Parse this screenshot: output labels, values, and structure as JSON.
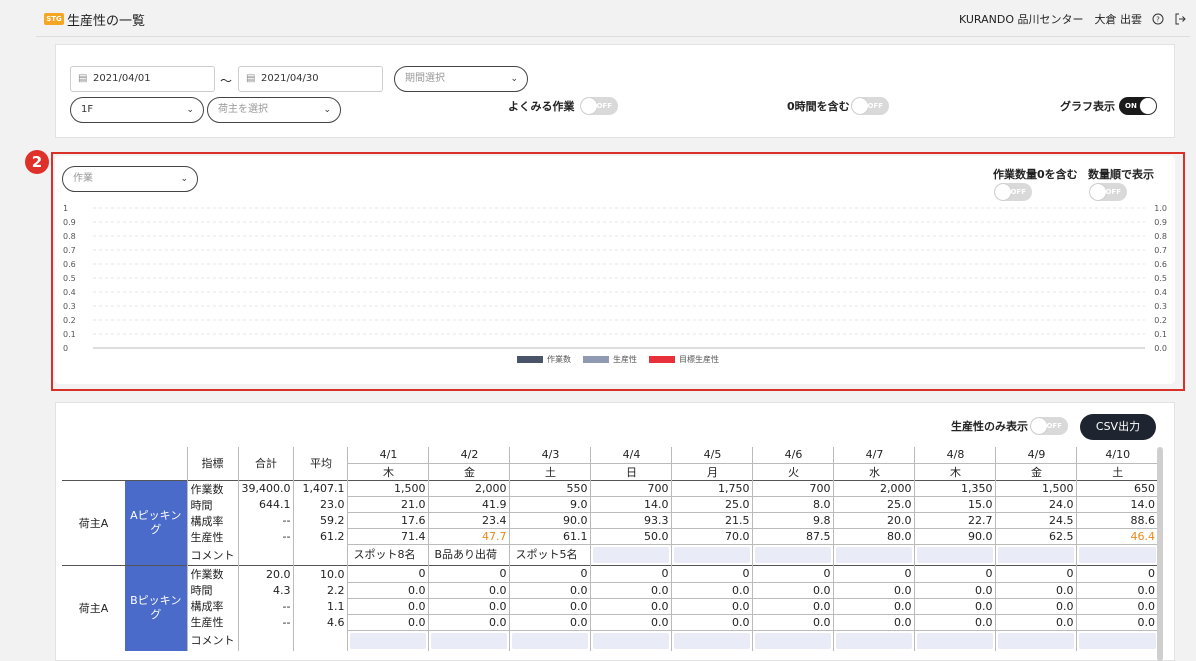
{
  "header": {
    "badge": "STG",
    "title": "生産性の一覧",
    "user_info": "KURANDO 品川センター　大倉 出雲"
  },
  "filters": {
    "date_from": "2021/04/01",
    "date_to": "2021/04/30",
    "tilde": "〜",
    "period_select_placeholder": "期間選択",
    "floor_value": "1F",
    "shipper_placeholder": "荷主を選択",
    "frequent_work_label": "よくみる作業",
    "frequent_work_toggle": "OFF",
    "include_zero_hours_label": "0時間を含む",
    "include_zero_hours_toggle": "OFF",
    "graph_display_label": "グラフ表示",
    "graph_display_toggle": "ON"
  },
  "chart_panel": {
    "step_number": "2",
    "work_select_placeholder": "作業",
    "include_zero_qty_label": "作業数量0を含む",
    "include_zero_qty_toggle": "OFF",
    "sort_by_qty_label": "数量順で表示",
    "sort_by_qty_toggle": "OFF"
  },
  "chart_data": {
    "type": "bar",
    "categories": [],
    "series": [
      {
        "name": "作業数",
        "values": [],
        "color": "#4a5468"
      },
      {
        "name": "生産性",
        "values": [],
        "color": "#8f9ab2"
      },
      {
        "name": "目標生産性",
        "values": [],
        "color": "#e8303a"
      }
    ],
    "y_left_ticks": [
      "1",
      "0.9",
      "0.8",
      "0.7",
      "0.6",
      "0.5",
      "0.4",
      "0.3",
      "0.2",
      "0.1",
      "0"
    ],
    "y_right_ticks": [
      "1.0",
      "0.9",
      "0.8",
      "0.7",
      "0.6",
      "0.5",
      "0.4",
      "0.3",
      "0.2",
      "0.1",
      "0.0"
    ],
    "ylim": [
      0,
      1
    ],
    "grid": true,
    "legend_position": "bottom-center"
  },
  "table_toolbar": {
    "productivity_only_label": "生産性のみ表示",
    "productivity_only_toggle": "OFF",
    "csv_button": "CSV出力"
  },
  "table": {
    "col_metric": "指標",
    "col_total": "合計",
    "col_avg": "平均",
    "dates": [
      "4/1",
      "4/2",
      "4/3",
      "4/4",
      "4/5",
      "4/6",
      "4/7",
      "4/8",
      "4/9",
      "4/10"
    ],
    "weekdays": [
      "木",
      "金",
      "土",
      "日",
      "月",
      "火",
      "水",
      "木",
      "金",
      "土"
    ],
    "groups": [
      {
        "shipper": "荷主A",
        "process": "Aピッキング",
        "rows": [
          {
            "metric": "作業数",
            "total": "39,400.0",
            "avg": "1,407.1",
            "values": [
              "1,500",
              "2,000",
              "550",
              "700",
              "1,750",
              "700",
              "2,000",
              "1,350",
              "1,500",
              "650"
            ]
          },
          {
            "metric": "時間",
            "total": "644.1",
            "avg": "23.0",
            "values": [
              "21.0",
              "41.9",
              "9.0",
              "14.0",
              "25.0",
              "8.0",
              "25.0",
              "15.0",
              "24.0",
              "14.0"
            ]
          },
          {
            "metric": "構成率",
            "total": "--",
            "avg": "59.2",
            "values": [
              "17.6",
              "23.4",
              "90.0",
              "93.3",
              "21.5",
              "9.8",
              "20.0",
              "22.7",
              "24.5",
              "88.6"
            ]
          },
          {
            "metric": "生産性",
            "total": "--",
            "avg": "61.2",
            "values": [
              "71.4",
              "47.7",
              "61.1",
              "50.0",
              "70.0",
              "87.5",
              "80.0",
              "90.0",
              "62.5",
              "46.4"
            ]
          }
        ],
        "comment_label": "コメント",
        "comments": [
          "スポット8名",
          "B品あり出荷",
          "スポット5名",
          "",
          "",
          "",
          "",
          "",
          "",
          ""
        ]
      },
      {
        "shipper": "荷主A",
        "process": "Bピッキング",
        "rows": [
          {
            "metric": "作業数",
            "total": "20.0",
            "avg": "10.0",
            "values": [
              "0",
              "0",
              "0",
              "0",
              "0",
              "0",
              "0",
              "0",
              "0",
              "0"
            ]
          },
          {
            "metric": "時間",
            "total": "4.3",
            "avg": "2.2",
            "values": [
              "0.0",
              "0.0",
              "0.0",
              "0.0",
              "0.0",
              "0.0",
              "0.0",
              "0.0",
              "0.0",
              "0.0"
            ]
          },
          {
            "metric": "構成率",
            "total": "--",
            "avg": "1.1",
            "values": [
              "0.0",
              "0.0",
              "0.0",
              "0.0",
              "0.0",
              "0.0",
              "0.0",
              "0.0",
              "0.0",
              "0.0"
            ]
          },
          {
            "metric": "生産性",
            "total": "--",
            "avg": "4.6",
            "values": [
              "0.0",
              "0.0",
              "0.0",
              "0.0",
              "0.0",
              "0.0",
              "0.0",
              "0.0",
              "0.0",
              "0.0"
            ]
          }
        ],
        "comment_label": "コメント",
        "comments": [
          "",
          "",
          "",
          "",
          "",
          "",
          "",
          "",
          "",
          ""
        ]
      }
    ]
  }
}
